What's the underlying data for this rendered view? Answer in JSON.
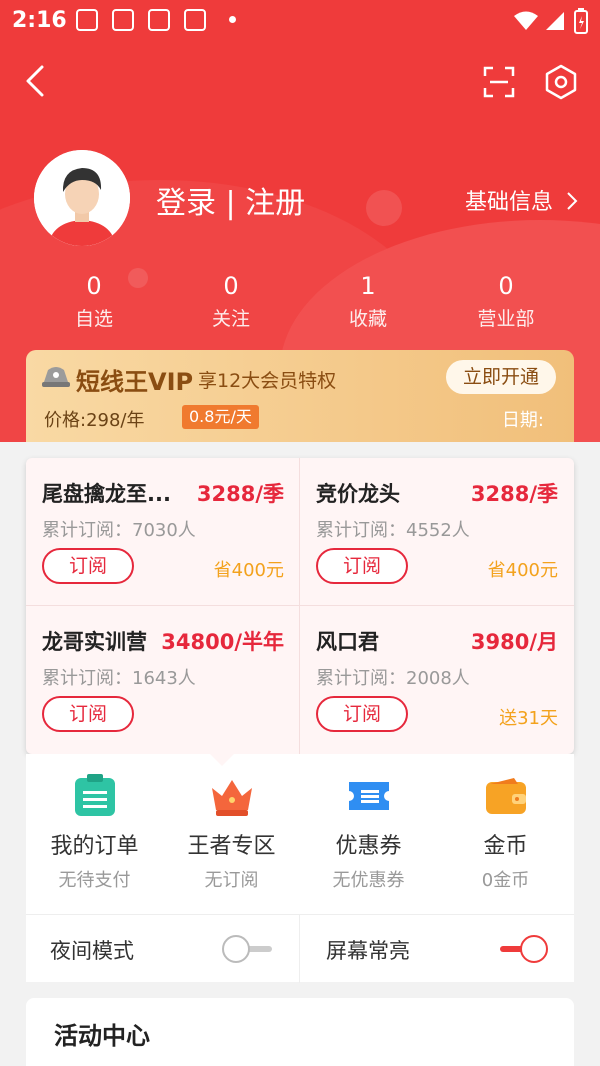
{
  "status_bar": {
    "time": "2:16"
  },
  "profile": {
    "login_text": "登录 | 注册",
    "basic_info": "基础信息",
    "stats": [
      {
        "value": "0",
        "label": "自选"
      },
      {
        "value": "0",
        "label": "关注"
      },
      {
        "value": "1",
        "label": "收藏"
      },
      {
        "value": "0",
        "label": "营业部"
      }
    ]
  },
  "vip": {
    "title": "短线王VIP",
    "subtitle": "享12大会员特权",
    "button": "立即开通",
    "price": "价格:298/年",
    "price_tag": "0.8元/天",
    "date": "日期:"
  },
  "products": [
    {
      "name": "尾盘擒龙至...",
      "price": "3288/季",
      "subs": "累计订阅：7030人",
      "button": "订阅",
      "note": "省400元"
    },
    {
      "name": "竞价龙头",
      "price": "3288/季",
      "subs": "累计订阅：4552人",
      "button": "订阅",
      "note": "省400元"
    },
    {
      "name": "龙哥实训营",
      "price": "34800/半年",
      "subs": "累计订阅：1643人",
      "button": "订阅",
      "note": ""
    },
    {
      "name": "风口君",
      "price": "3980/月",
      "subs": "累计订阅：2008人",
      "button": "订阅",
      "note": "送31天"
    }
  ],
  "menu": [
    {
      "title": "我的订单",
      "sub": "无待支付",
      "icon": "order-icon"
    },
    {
      "title": "王者专区",
      "sub": "无订阅",
      "icon": "crown-icon"
    },
    {
      "title": "优惠券",
      "sub": "无优惠券",
      "icon": "coupon-icon"
    },
    {
      "title": "金币",
      "sub": "0金币",
      "icon": "wallet-icon"
    }
  ],
  "toggles": {
    "night_mode": {
      "label": "夜间模式",
      "on": false
    },
    "screen_on": {
      "label": "屏幕常亮",
      "on": true
    }
  },
  "activity": {
    "title": "活动中心"
  },
  "colors": {
    "brand_red": "#ef3b3b",
    "price_red": "#e6283c",
    "gold": "#f3a21d"
  }
}
